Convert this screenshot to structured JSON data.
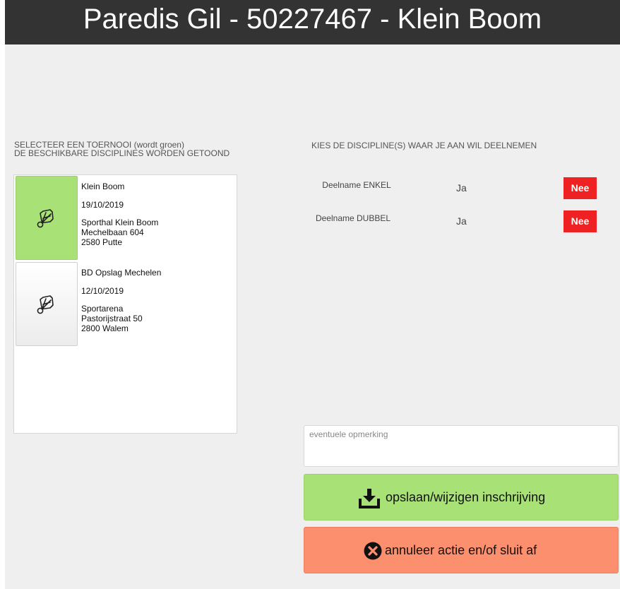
{
  "header": {
    "title": "Paredis Gil - 50227467 - Klein Boom"
  },
  "left_panel": {
    "instruction_line1": "SELECTEER EEN TOERNOOI (wordt groen)",
    "instruction_line2": "DE BESCHIKBARE DISCIPLINES WORDEN GETOOND",
    "tournaments": [
      {
        "name": "Klein Boom",
        "date": "19/10/2019",
        "venue": "Sporthal Klein Boom",
        "street": "Mechelbaan 604",
        "city": "2580 Putte",
        "selected": true,
        "icon": "shuttlecock-icon"
      },
      {
        "name": "BD Opslag Mechelen",
        "date": "12/10/2019",
        "venue": "Sportarena",
        "street": "Pastorijstraat 50",
        "city": "2800 Walem",
        "selected": false,
        "icon": "shuttlecock-icon"
      }
    ]
  },
  "right_panel": {
    "instruction": "KIES DE DISCIPLINE(S) WAAR JE AAN WIL DEELNEMEN",
    "disciplines": [
      {
        "label": "Deelname ENKEL",
        "yes_label": "Ja",
        "no_label": "Nee",
        "selected": "Nee"
      },
      {
        "label": "Deelname DUBBEL",
        "yes_label": "Ja",
        "no_label": "Nee",
        "selected": "Nee"
      }
    ],
    "remark_placeholder": "eventuele opmerking",
    "save_label": "opslaan/wijzigen inschrijving",
    "cancel_label": "annuleer actie en/of sluit af"
  },
  "colors": {
    "header_bg": "#333333",
    "selected_green": "#a8e277",
    "nee_red": "#ee2222",
    "cancel_salmon": "#fc8f6e",
    "background": "#efefef"
  }
}
